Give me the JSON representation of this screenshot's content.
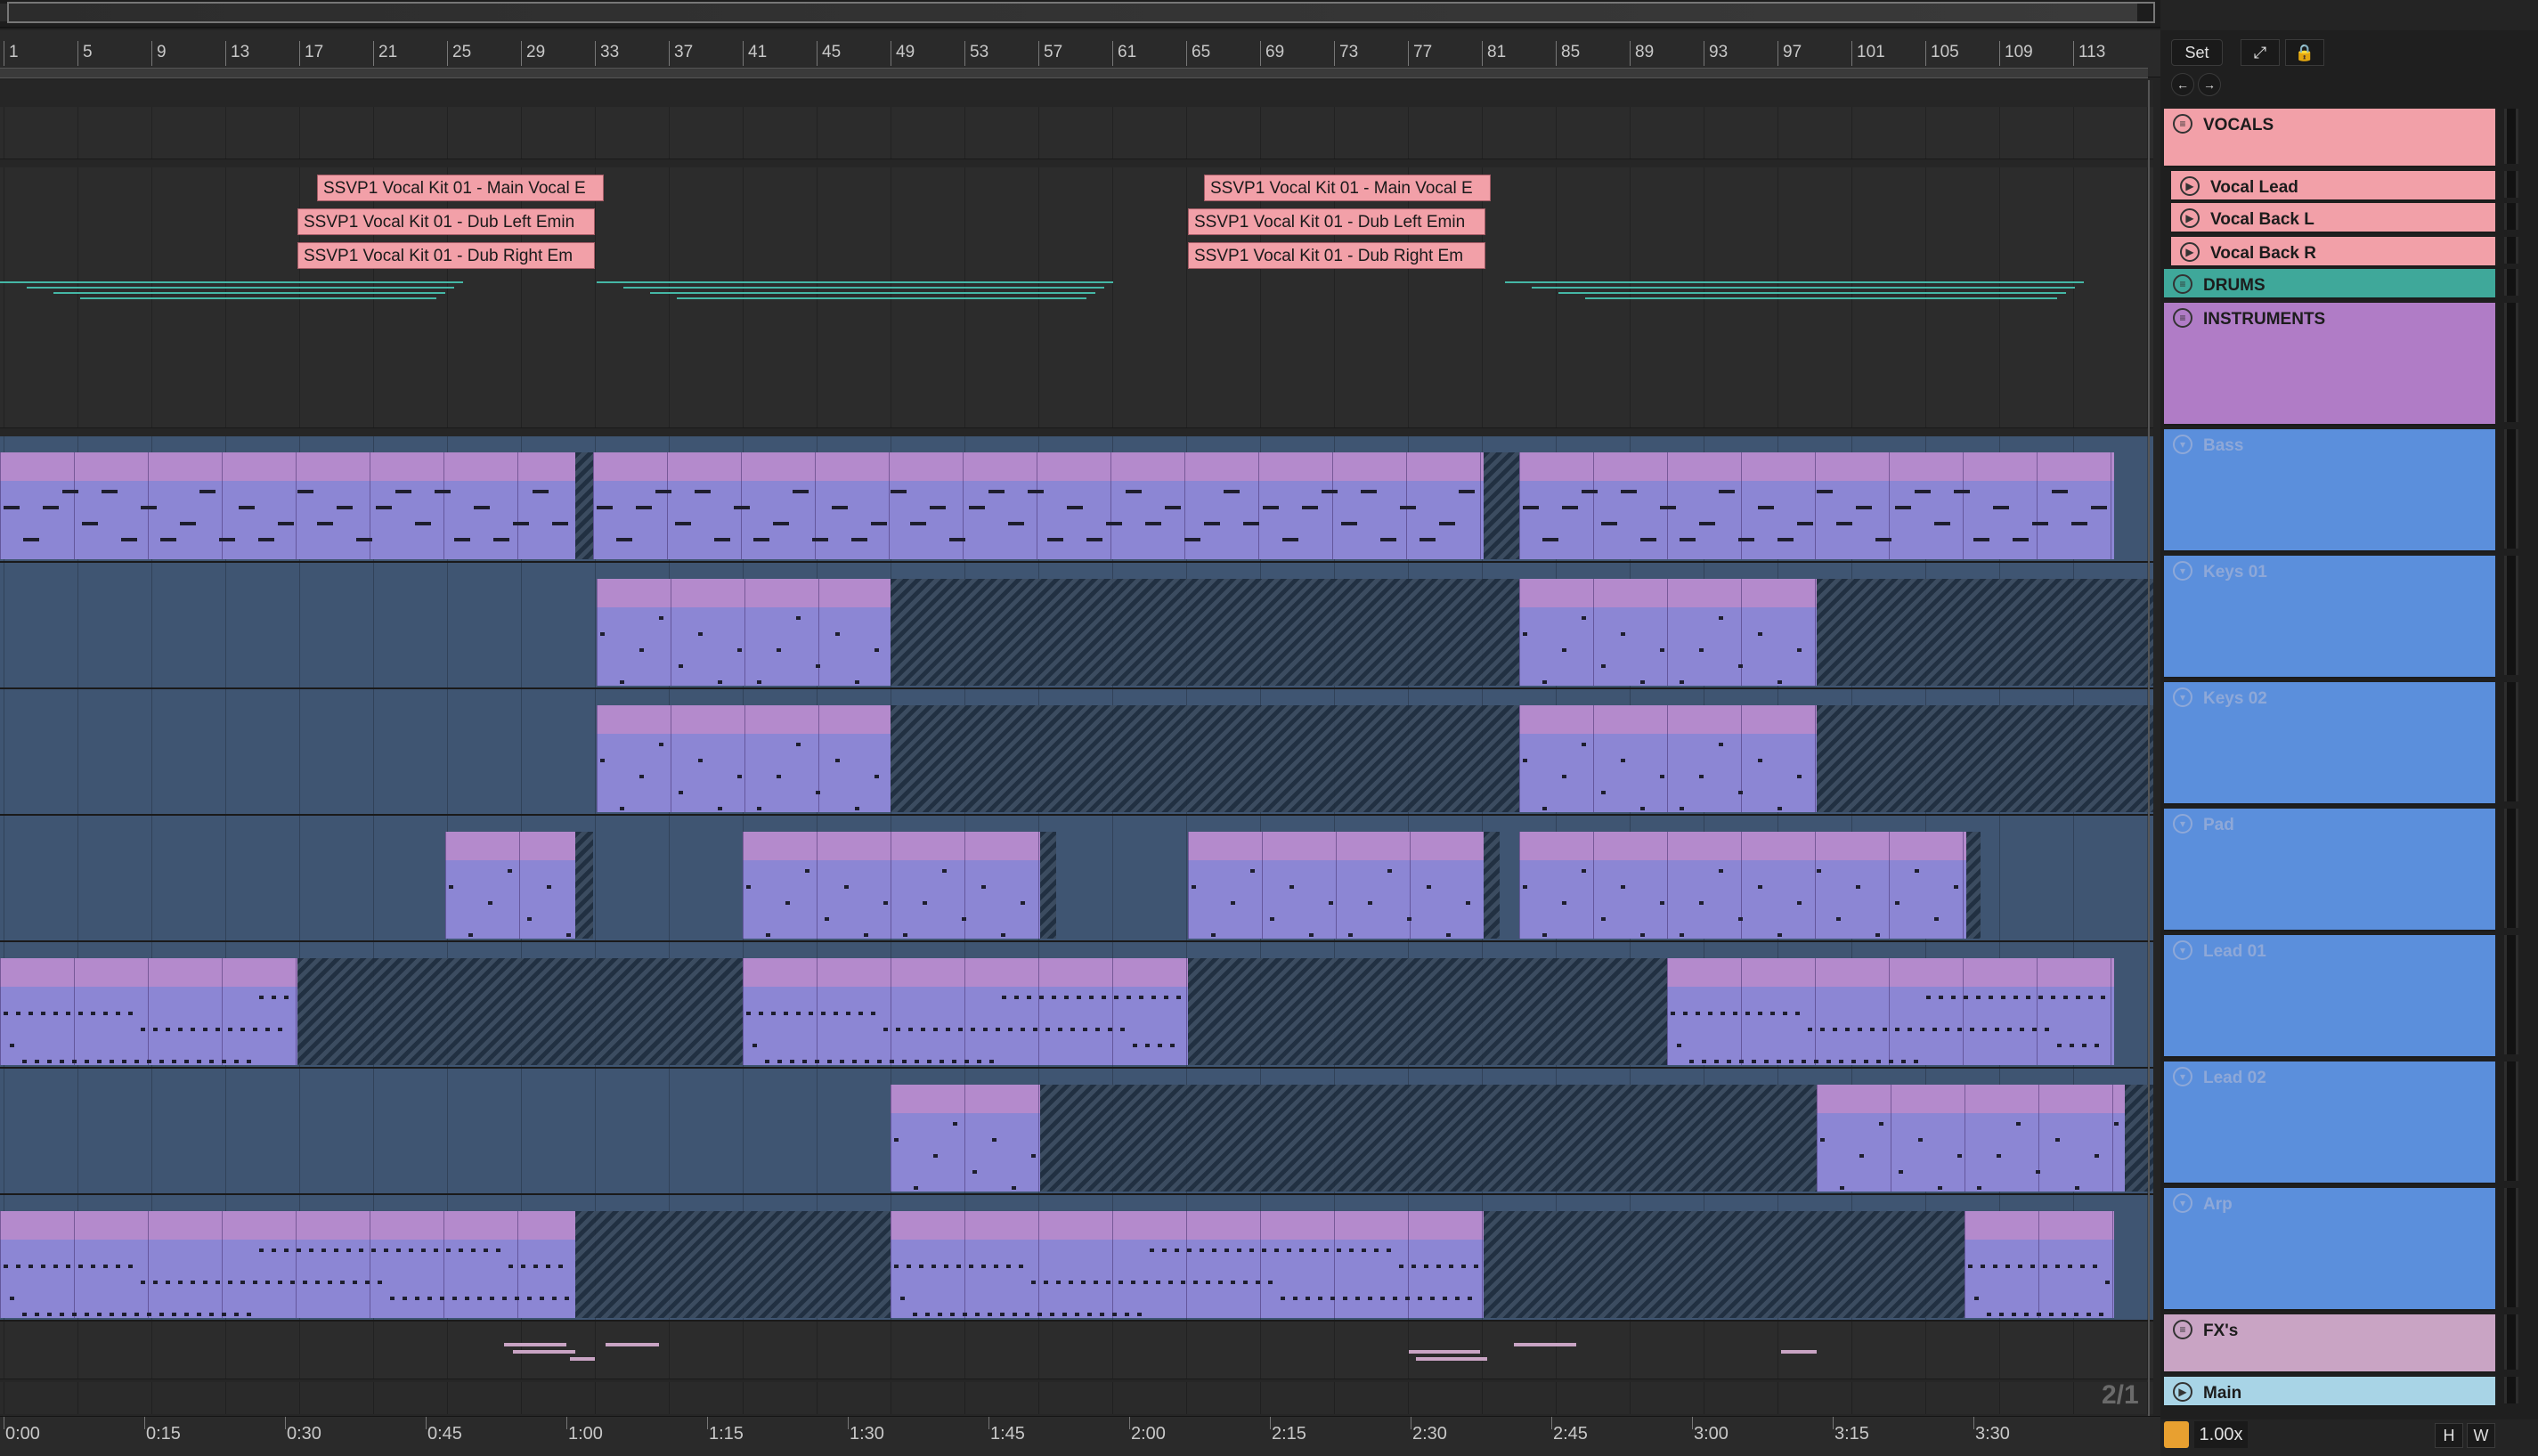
{
  "ruler": {
    "bars": [
      "1",
      "5",
      "9",
      "13",
      "17",
      "21",
      "25",
      "29",
      "33",
      "37",
      "41",
      "45",
      "49",
      "53",
      "57",
      "61",
      "65",
      "69",
      "73",
      "77",
      "81",
      "85",
      "89",
      "93",
      "97",
      "101",
      "105",
      "109",
      "113"
    ]
  },
  "time_ruler": {
    "labels": [
      "0:00",
      "0:15",
      "0:30",
      "0:45",
      "1:00",
      "1:15",
      "1:30",
      "1:45",
      "2:00",
      "2:15",
      "2:30",
      "2:45",
      "3:00",
      "3:15",
      "3:30"
    ]
  },
  "controls": {
    "set_label": "Set",
    "expand_icon": "expand-arrows-icon",
    "lock_icon": "lock-icon",
    "back_icon": "arrow-left-icon",
    "forward_icon": "arrow-right-icon",
    "page_indicator": "2/1",
    "zoom_value": "1.00x",
    "h_label": "H",
    "w_label": "W"
  },
  "vocal_clips": {
    "main": "SSVP1 Vocal Kit 01 - Main Vocal E",
    "dub_left": "SSVP1 Vocal Kit 01 - Dub Left Emin",
    "dub_right": "SSVP1 Vocal Kit 01 - Dub Right Em"
  },
  "tracks": [
    {
      "name": "VOCALS",
      "type": "group",
      "color": "#f2a0a8"
    },
    {
      "name": "Vocal Lead",
      "type": "audio",
      "color": "#f2a0a8"
    },
    {
      "name": "Vocal Back L",
      "type": "audio",
      "color": "#f2a0a8"
    },
    {
      "name": "Vocal Back R",
      "type": "audio",
      "color": "#f2a0a8"
    },
    {
      "name": "DRUMS",
      "type": "group",
      "color": "#3fa89a"
    },
    {
      "name": "INSTRUMENTS",
      "type": "group",
      "color": "#b07cc6"
    },
    {
      "name": "Bass",
      "type": "midi",
      "color": "#5b8fdc"
    },
    {
      "name": "Keys 01",
      "type": "midi",
      "color": "#5b8fdc"
    },
    {
      "name": "Keys 02",
      "type": "midi",
      "color": "#5b8fdc"
    },
    {
      "name": "Pad",
      "type": "midi",
      "color": "#5b8fdc"
    },
    {
      "name": "Lead 01",
      "type": "midi",
      "color": "#5b8fdc"
    },
    {
      "name": "Lead 02",
      "type": "midi",
      "color": "#5b8fdc"
    },
    {
      "name": "Arp",
      "type": "midi",
      "color": "#5b8fdc"
    },
    {
      "name": "FX's",
      "type": "group",
      "color": "#c9a4c4"
    },
    {
      "name": "Main",
      "type": "main",
      "color": "#a8d4e6"
    }
  ]
}
